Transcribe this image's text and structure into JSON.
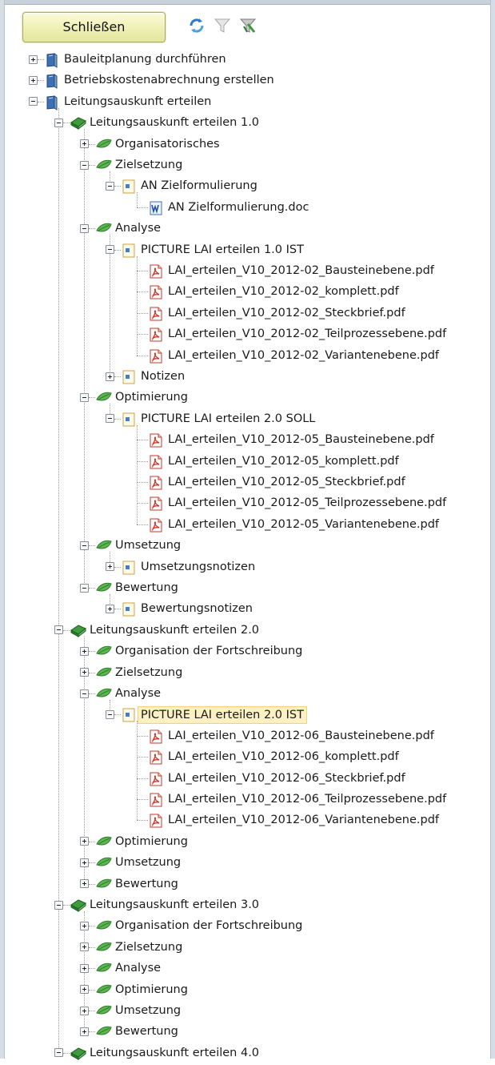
{
  "toolbar": {
    "close_label": "Schließen",
    "icons": [
      "refresh-icon",
      "filter-icon",
      "filter-clear-icon"
    ]
  },
  "tree": [
    {
      "level": 0,
      "expander": "plus",
      "icon": "book-blue",
      "label": "Bauleitplanung durchführen"
    },
    {
      "level": 0,
      "expander": "plus",
      "icon": "book-blue",
      "label": "Betriebskostenabrechnung erstellen"
    },
    {
      "level": 0,
      "expander": "minus",
      "icon": "book-blue",
      "label": "Leitungsauskunft erteilen"
    },
    {
      "level": 1,
      "expander": "minus",
      "icon": "book-green",
      "label": "Leitungsauskunft erteilen 1.0"
    },
    {
      "level": 2,
      "expander": "plus",
      "icon": "leaf-green",
      "label": "Organisatorisches"
    },
    {
      "level": 2,
      "expander": "minus",
      "icon": "leaf-green",
      "label": "Zielsetzung"
    },
    {
      "level": 3,
      "expander": "minus",
      "icon": "doc-page",
      "label": "AN Zielformulierung"
    },
    {
      "level": 4,
      "expander": "none",
      "icon": "word-file",
      "label": "AN Zielformulierung.doc"
    },
    {
      "level": 2,
      "expander": "minus",
      "icon": "leaf-green",
      "label": "Analyse"
    },
    {
      "level": 3,
      "expander": "minus",
      "icon": "doc-page",
      "label": "PICTURE LAI erteilen 1.0 IST"
    },
    {
      "level": 4,
      "expander": "none",
      "icon": "pdf-file",
      "label": "LAI_erteilen_V10_2012-02_Bausteinebene.pdf"
    },
    {
      "level": 4,
      "expander": "none",
      "icon": "pdf-file",
      "label": "LAI_erteilen_V10_2012-02_komplett.pdf"
    },
    {
      "level": 4,
      "expander": "none",
      "icon": "pdf-file",
      "label": "LAI_erteilen_V10_2012-02_Steckbrief.pdf"
    },
    {
      "level": 4,
      "expander": "none",
      "icon": "pdf-file",
      "label": "LAI_erteilen_V10_2012-02_Teilprozessebene.pdf"
    },
    {
      "level": 4,
      "expander": "none",
      "icon": "pdf-file",
      "label": "LAI_erteilen_V10_2012-02_Variantenebene.pdf"
    },
    {
      "level": 3,
      "expander": "plus",
      "icon": "doc-page",
      "label": "Notizen"
    },
    {
      "level": 2,
      "expander": "minus",
      "icon": "leaf-green",
      "label": "Optimierung"
    },
    {
      "level": 3,
      "expander": "minus",
      "icon": "doc-page",
      "label": "PICTURE LAI erteilen 2.0 SOLL"
    },
    {
      "level": 4,
      "expander": "none",
      "icon": "pdf-file",
      "label": "LAI_erteilen_V10_2012-05_Bausteinebene.pdf"
    },
    {
      "level": 4,
      "expander": "none",
      "icon": "pdf-file",
      "label": "LAI_erteilen_V10_2012-05_komplett.pdf"
    },
    {
      "level": 4,
      "expander": "none",
      "icon": "pdf-file",
      "label": "LAI_erteilen_V10_2012-05_Steckbrief.pdf"
    },
    {
      "level": 4,
      "expander": "none",
      "icon": "pdf-file",
      "label": "LAI_erteilen_V10_2012-05_Teilprozessebene.pdf"
    },
    {
      "level": 4,
      "expander": "none",
      "icon": "pdf-file",
      "label": "LAI_erteilen_V10_2012-05_Variantenebene.pdf"
    },
    {
      "level": 2,
      "expander": "minus",
      "icon": "leaf-green",
      "label": "Umsetzung"
    },
    {
      "level": 3,
      "expander": "plus",
      "icon": "doc-page",
      "label": "Umsetzungsnotizen"
    },
    {
      "level": 2,
      "expander": "minus",
      "icon": "leaf-green",
      "label": "Bewertung"
    },
    {
      "level": 3,
      "expander": "plus",
      "icon": "doc-page",
      "label": "Bewertungsnotizen"
    },
    {
      "level": 1,
      "expander": "minus",
      "icon": "book-green",
      "label": "Leitungsauskunft erteilen 2.0"
    },
    {
      "level": 2,
      "expander": "plus",
      "icon": "leaf-green",
      "label": "Organisation der Fortschreibung"
    },
    {
      "level": 2,
      "expander": "plus",
      "icon": "leaf-green",
      "label": "Zielsetzung"
    },
    {
      "level": 2,
      "expander": "minus",
      "icon": "leaf-green",
      "label": "Analyse"
    },
    {
      "level": 3,
      "expander": "minus",
      "icon": "doc-page",
      "label": "PICTURE LAI erteilen 2.0 IST",
      "selected": true
    },
    {
      "level": 4,
      "expander": "none",
      "icon": "pdf-file",
      "label": "LAI_erteilen_V10_2012-06_Bausteinebene.pdf"
    },
    {
      "level": 4,
      "expander": "none",
      "icon": "pdf-file",
      "label": "LAI_erteilen_V10_2012-06_komplett.pdf"
    },
    {
      "level": 4,
      "expander": "none",
      "icon": "pdf-file",
      "label": "LAI_erteilen_V10_2012-06_Steckbrief.pdf"
    },
    {
      "level": 4,
      "expander": "none",
      "icon": "pdf-file",
      "label": "LAI_erteilen_V10_2012-06_Teilprozessebene.pdf"
    },
    {
      "level": 4,
      "expander": "none",
      "icon": "pdf-file",
      "label": "LAI_erteilen_V10_2012-06_Variantenebene.pdf"
    },
    {
      "level": 2,
      "expander": "plus",
      "icon": "leaf-green",
      "label": "Optimierung"
    },
    {
      "level": 2,
      "expander": "plus",
      "icon": "leaf-green",
      "label": "Umsetzung"
    },
    {
      "level": 2,
      "expander": "plus",
      "icon": "leaf-green",
      "label": "Bewertung"
    },
    {
      "level": 1,
      "expander": "minus",
      "icon": "book-green",
      "label": "Leitungsauskunft erteilen 3.0"
    },
    {
      "level": 2,
      "expander": "plus",
      "icon": "leaf-green",
      "label": "Organisation der Fortschreibung"
    },
    {
      "level": 2,
      "expander": "plus",
      "icon": "leaf-green",
      "label": "Zielsetzung"
    },
    {
      "level": 2,
      "expander": "plus",
      "icon": "leaf-green",
      "label": "Analyse"
    },
    {
      "level": 2,
      "expander": "plus",
      "icon": "leaf-green",
      "label": "Optimierung"
    },
    {
      "level": 2,
      "expander": "plus",
      "icon": "leaf-green",
      "label": "Umsetzung"
    },
    {
      "level": 2,
      "expander": "plus",
      "icon": "leaf-green",
      "label": "Bewertung"
    },
    {
      "level": 1,
      "expander": "minus",
      "icon": "book-green",
      "label": "Leitungsauskunft erteilen 4.0"
    }
  ]
}
